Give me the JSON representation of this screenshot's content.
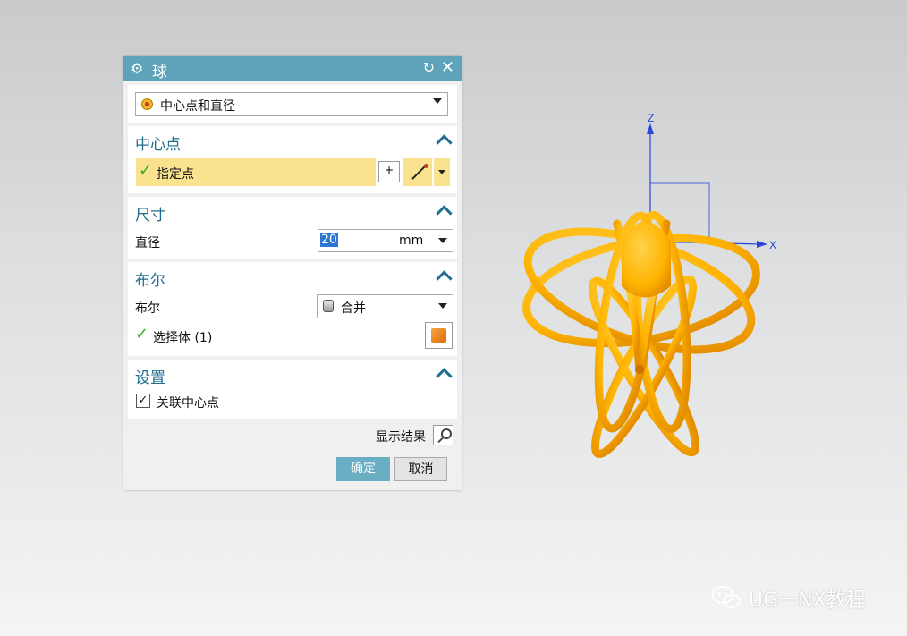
{
  "dialog": {
    "title": "球",
    "type_select": {
      "value": "中心点和直径"
    },
    "center_section": {
      "title": "中心点",
      "specify_point": "指定点"
    },
    "size_section": {
      "title": "尺寸",
      "diameter_label": "直径",
      "diameter_value": "20",
      "unit": "mm"
    },
    "boolean_section": {
      "title": "布尔",
      "boolean_label": "布尔",
      "boolean_value": "合并",
      "select_body": "选择体 (1)"
    },
    "settings_section": {
      "title": "设置",
      "associative_center": "关联中心点",
      "associative_checked": true
    },
    "show_result": "显示结果",
    "ok": "确定",
    "cancel": "取消"
  },
  "viewport": {
    "axis_z": "Z",
    "axis_x": "X",
    "model_color": "#ffb400",
    "axis_color": "#2846d8"
  },
  "watermark": "UG一NX教程",
  "colors": {
    "title_bar": "#5ea3b9",
    "section_title": "#1f6d8f",
    "highlight_row": "#fbe28f",
    "check": "#2eae2e",
    "selection": "#2d78d6"
  }
}
